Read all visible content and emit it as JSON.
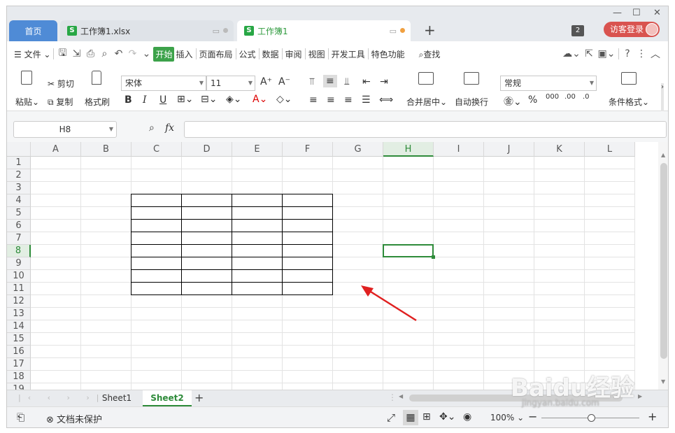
{
  "tabs": {
    "home": "首页",
    "file1": "工作簿1.xlsx",
    "file2": "工作簿1",
    "badge_count": "2",
    "login": "访客登录"
  },
  "menu": {
    "file": "文件",
    "items": [
      "开始",
      "插入",
      "页面布局",
      "公式",
      "数据",
      "审阅",
      "视图",
      "开发工具",
      "特色功能"
    ],
    "search": "查找"
  },
  "ribbon": {
    "paste": "粘贴",
    "cut": "剪切",
    "copy": "复制",
    "format_painter": "格式刷",
    "font_name": "宋体",
    "font_size": "11",
    "merge_center": "合并居中",
    "wrap_text": "自动换行",
    "number_format": "常规",
    "conditional_format": "条件格式"
  },
  "formula_bar": {
    "name_box": "H8",
    "fx": "fx"
  },
  "grid": {
    "columns": [
      "A",
      "B",
      "C",
      "D",
      "E",
      "F",
      "G",
      "H",
      "I",
      "J",
      "K",
      "L"
    ],
    "rows": [
      "1",
      "2",
      "3",
      "4",
      "5",
      "6",
      "7",
      "8",
      "9",
      "10",
      "11",
      "12",
      "13",
      "14",
      "15",
      "16",
      "17",
      "18",
      "19"
    ],
    "selected_column": "H",
    "selected_row": "8"
  },
  "sheets": {
    "tabs": [
      "Sheet1",
      "Sheet2"
    ],
    "active": "Sheet2"
  },
  "status": {
    "protect": "文档未保护",
    "zoom": "100%"
  },
  "watermark": {
    "logo": "Baidu经验",
    "url": "jingyan.baidu.com"
  },
  "colors": {
    "accent_green": "#2e8b3a",
    "home_tab_blue": "#4f8bd6",
    "login_red": "#d9534f",
    "arrow_red": "#e02020"
  }
}
